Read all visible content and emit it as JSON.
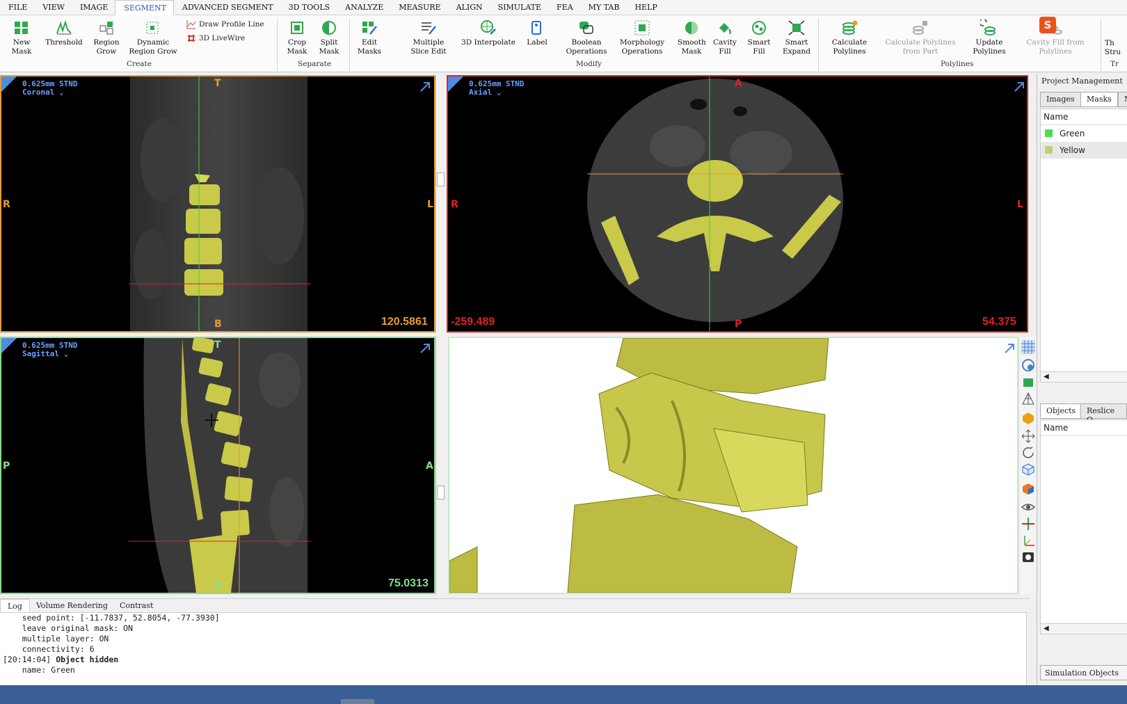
{
  "menu": [
    "FILE",
    "VIEW",
    "IMAGE",
    "SEGMENT",
    "ADVANCED SEGMENT",
    "3D TOOLS",
    "ANALYZE",
    "MEASURE",
    "ALIGN",
    "SIMULATE",
    "FEA",
    "MY TAB",
    "HELP"
  ],
  "ribbon": {
    "new_mask": "New Mask",
    "threshold": "Threshold",
    "region_grow": "Region Grow",
    "dynamic_region_grow": "Dynamic Region Grow",
    "draw_profile_line": "Draw Profile Line",
    "livewire": "3D LiveWire",
    "group_create": "Create",
    "crop_mask": "Crop Mask",
    "split_mask": "Split Mask",
    "group_separate": "Separate",
    "edit_masks": "Edit Masks",
    "multiple_slice_edit": "Multiple Slice Edit",
    "interpolate": "3D Interpolate",
    "label": "Label",
    "boolean": "Boolean Operations",
    "morphology": "Morphology Operations",
    "smooth_mask": "Smooth Mask",
    "cavity_fill": "Cavity Fill",
    "smart_fill": "Smart Fill",
    "smart_expand": "Smart Expand",
    "group_modify": "Modify",
    "calc_polylines": "Calculate Polylines",
    "calc_polylines_part": "Calculate Polylines from Part",
    "update_polylines": "Update Polylines",
    "cavity_fill_polylines": "Cavity Fill from Polylines",
    "group_polylines": "Polylines",
    "thin_struct": "Th Stru",
    "group_tr": "Tr"
  },
  "viewports": {
    "coronal": {
      "res": "0.625mm STND",
      "view": "Coronal",
      "top": "T",
      "bottom": "B",
      "left": "R",
      "right": "L",
      "coord": "120.5861"
    },
    "axial": {
      "res": "0.625mm STND",
      "view": "Axial",
      "top": "A",
      "bottom": "P",
      "left": "R",
      "right": "L",
      "coord": "54.375",
      "coord_left": "-259.489"
    },
    "sagittal": {
      "res": "0.625mm STND",
      "view": "Sagittal",
      "top": "T",
      "bottom": "B",
      "left": "P",
      "right": "A",
      "coord": "75.0313"
    }
  },
  "bottom_tabs": [
    "Log",
    "Volume Rendering",
    "Contrast"
  ],
  "log_lines": [
    "    seed point: [-11.7837, 52.8054, -77.3930]",
    "    leave original mask: ON",
    "    multiple layer: ON",
    "    connectivity: 6"
  ],
  "log_event": {
    "time": "[20:14:04]",
    "title": "Object hidden",
    "detail": "    name: Green"
  },
  "right_panel": {
    "title": "Project Management",
    "tabs": [
      "Images",
      "Masks",
      "Me"
    ],
    "name_header": "Name",
    "masks": [
      {
        "name": "Green",
        "color": "#4fdc4f"
      },
      {
        "name": "Yellow",
        "color": "#b9d27a"
      }
    ],
    "lower_tabs": [
      "Objects",
      "Reslice O"
    ],
    "objects_header": "Name",
    "sim_button": "Simulation Objects"
  },
  "colors": {
    "accent": "#2a55b0",
    "bone": "#d8d858",
    "status": "#3a5f95"
  }
}
